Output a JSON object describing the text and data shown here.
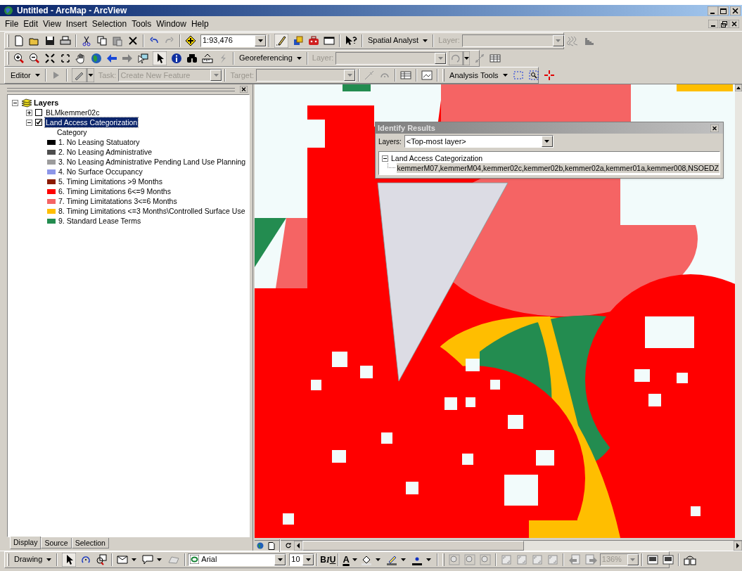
{
  "window": {
    "title": "Untitled - ArcMap - ArcView"
  },
  "menu": [
    "File",
    "Edit",
    "View",
    "Insert",
    "Selection",
    "Tools",
    "Window",
    "Help"
  ],
  "standard_toolbar": {
    "scale": "1:93,476",
    "spatial_analyst": "Spatial Analyst",
    "layer_label": "Layer:"
  },
  "georef_toolbar": {
    "menu": "Georeferencing",
    "layer_label": "Layer:"
  },
  "editor_toolbar": {
    "menu": "Editor",
    "task_label": "Task:",
    "task_value": "Create New Feature",
    "target_label": "Target:",
    "analysis_menu": "Analysis Tools"
  },
  "toc": {
    "root": "Layers",
    "expanded": true,
    "layers": [
      {
        "label": "BLMkemmer02c",
        "checked": false,
        "expanded": false,
        "selected": false
      },
      {
        "label": "Land Access Categorization",
        "checked": true,
        "expanded": true,
        "selected": true,
        "legend_heading": "Category",
        "legend": [
          {
            "label": "1. No Leasing Statuatory",
            "color": "#000000"
          },
          {
            "label": "2. No Leasing Administrative",
            "color": "#4e4e4e"
          },
          {
            "label": "3. No Leasing Administrative Pending Land Use Planning",
            "color": "#9c9c9c"
          },
          {
            "label": "4. No Surface Occupancy",
            "color": "#8c96e8"
          },
          {
            "label": "5. Timing Limitations >9 Months",
            "color": "#8b1a00"
          },
          {
            "label": "6. Timing Limitations 6<=9 Months",
            "color": "#ff0000"
          },
          {
            "label": "7. Timing Limitatations 3<=6 Months",
            "color": "#f56464"
          },
          {
            "label": "8. Timing Limitations <=3 Months\\Controlled Surface Use",
            "color": "#ffbe00"
          },
          {
            "label": "9. Standard Lease Terms",
            "color": "#238c50"
          }
        ]
      }
    ]
  },
  "toc_tabs": [
    {
      "label": "Display",
      "selected": true
    },
    {
      "label": "Source",
      "selected": false
    },
    {
      "label": "Selection",
      "selected": false
    }
  ],
  "identify": {
    "title": "Identify Results",
    "layers_label": "Layers:",
    "layers_value": "<Top-most layer>",
    "tree": {
      "label": "Land Access Categorization",
      "expanded": true,
      "children": [
        {
          "label": "kemmerM07,kemmerM04,kemmer02c,kemmer02b,kemmer02a,kemmer01a,kemmer008,NSOEDZ",
          "selected": true
        }
      ]
    }
  },
  "drawing_toolbar": {
    "menu": "Drawing",
    "font": "Arial",
    "size": "10",
    "format_buttons": [
      "B",
      "I",
      "U"
    ],
    "font_color_glyph": "A",
    "zoom": "136%"
  }
}
